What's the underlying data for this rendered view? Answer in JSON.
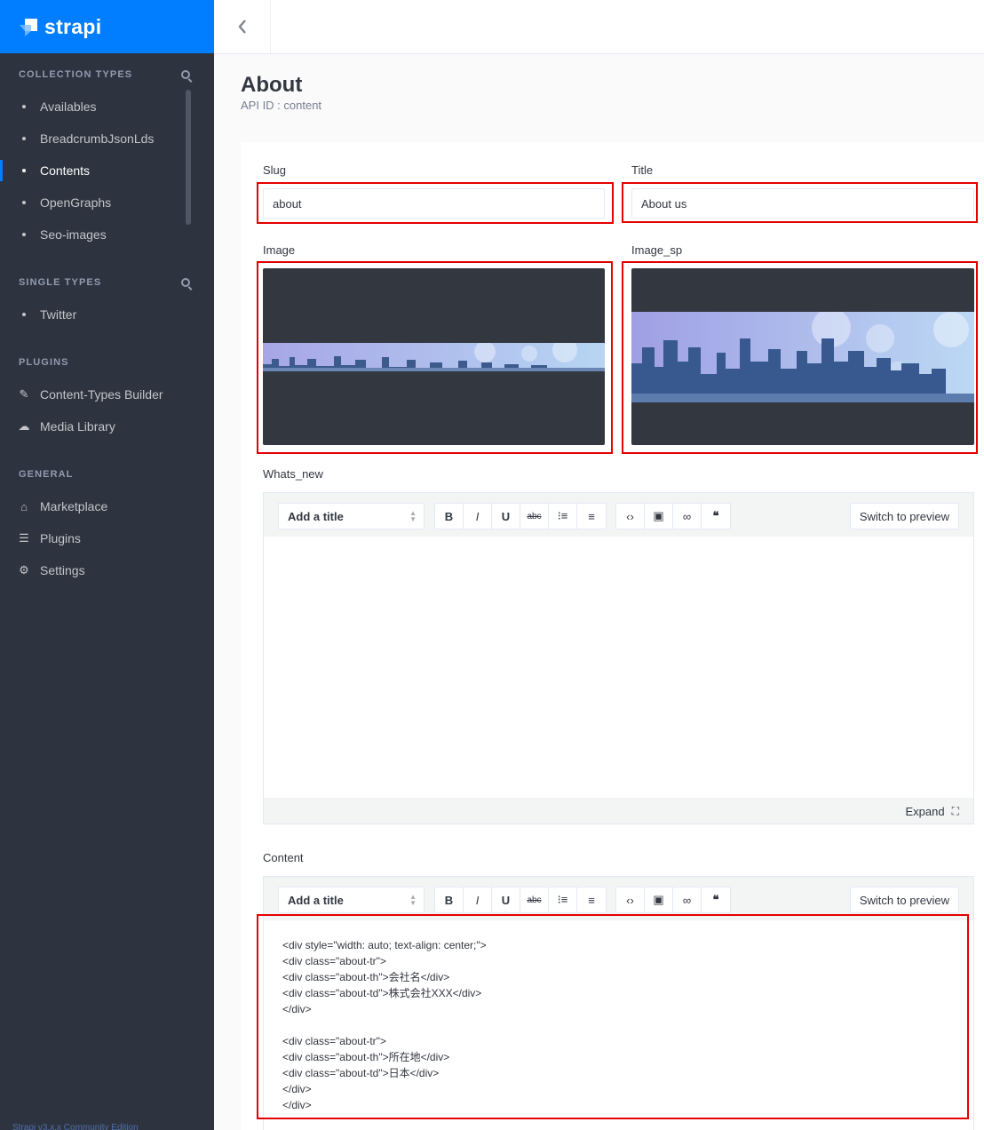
{
  "brand": {
    "name": "strapi",
    "color": "#007eff"
  },
  "sidebar": {
    "collection_types_label": "COLLECTION TYPES",
    "collection_types": [
      {
        "label": "Availables",
        "active": false
      },
      {
        "label": "BreadcrumbJsonLds",
        "active": false
      },
      {
        "label": "Contents",
        "active": true
      },
      {
        "label": "OpenGraphs",
        "active": false
      },
      {
        "label": "Seo-images",
        "active": false
      }
    ],
    "single_types_label": "SINGLE TYPES",
    "single_types": [
      {
        "label": "Twitter"
      }
    ],
    "plugins_label": "PLUGINS",
    "plugins": [
      {
        "label": "Content-Types Builder",
        "icon": "paintbrush-icon"
      },
      {
        "label": "Media Library",
        "icon": "cloud-upload-icon"
      }
    ],
    "general_label": "GENERAL",
    "general": [
      {
        "label": "Marketplace",
        "icon": "shop-icon"
      },
      {
        "label": "Plugins",
        "icon": "list-icon"
      },
      {
        "label": "Settings",
        "icon": "gear-icon"
      }
    ],
    "footer": "Strapi v3.x.x Community Edition"
  },
  "header": {
    "title": "About",
    "subtitle": "API ID : content"
  },
  "fields": {
    "slug": {
      "label": "Slug",
      "value": "about"
    },
    "title": {
      "label": "Title",
      "value": "About us"
    },
    "image": {
      "label": "Image"
    },
    "image_sp": {
      "label": "Image_sp"
    },
    "whats_new": {
      "label": "Whats_new"
    },
    "content": {
      "label": "Content"
    }
  },
  "editor": {
    "select_label": "Add a title",
    "preview_label": "Switch to preview",
    "expand_label": "Expand",
    "buttons": {
      "bold": "B",
      "italic": "I",
      "underline": "U",
      "strike": "abc"
    }
  },
  "content_code": [
    "<div style=\"width: auto; text-align: center;\">",
    "<div class=\"about-tr\">",
    "<div class=\"about-th\">会社名</div>",
    "<div class=\"about-td\">株式会社XXX</div>",
    "</div>",
    "",
    "<div class=\"about-tr\">",
    "<div class=\"about-th\">所在地</div>",
    "<div class=\"about-td\">日本</div>",
    "</div>",
    "</div>"
  ]
}
